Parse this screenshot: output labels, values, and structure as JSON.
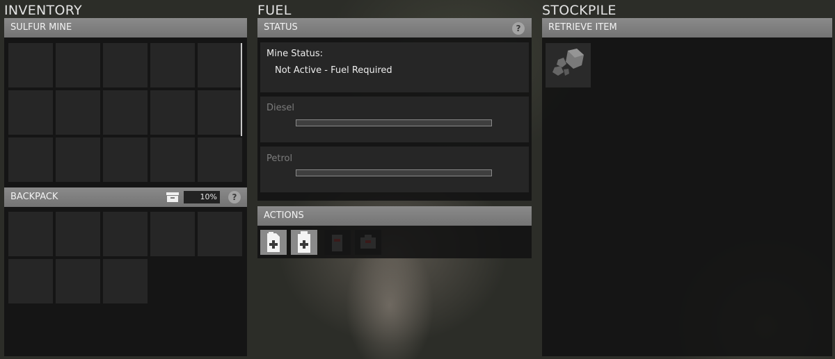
{
  "inventory": {
    "title": "INVENTORY",
    "mine_header": "SULFUR MINE",
    "mine_slots": 15,
    "backpack_header": "BACKPACK",
    "backpack_percent": "10%",
    "backpack_slots": 8
  },
  "fuel": {
    "title": "FUEL",
    "status_header": "STATUS",
    "status_label": "Mine Status:",
    "status_value": "Not Active - Fuel Required",
    "diesel_label": "Diesel",
    "diesel_fill": 0,
    "petrol_label": "Petrol",
    "petrol_fill": 0,
    "actions_header": "ACTIONS",
    "actions": [
      "add-diesel",
      "add-petrol",
      "disabled-action-1",
      "disabled-action-2"
    ]
  },
  "stockpile": {
    "title": "STOCKPILE",
    "retrieve_header": "RETRIEVE ITEM",
    "item_icon": "sulfur-ore-icon"
  },
  "help_glyph": "?"
}
